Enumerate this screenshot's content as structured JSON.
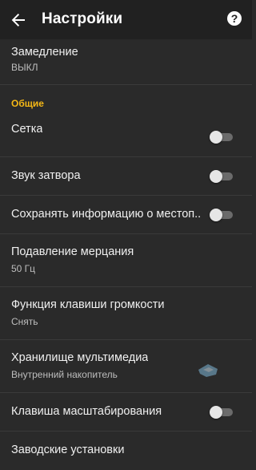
{
  "appbar": {
    "title": "Настройки",
    "back_icon": "arrow-back-icon",
    "help_icon": "help-icon",
    "help_glyph": "?"
  },
  "items": [
    {
      "title": "Замедление",
      "value": "ВЫКЛ"
    }
  ],
  "section": {
    "label": "Общие"
  },
  "general": {
    "grid": {
      "title": "Сетка",
      "toggle_on": false
    },
    "shutter_sound": {
      "title": "Звук затвора",
      "toggle_on": false
    },
    "save_location": {
      "title": "Сохранять информацию о местоп..",
      "toggle_on": false
    },
    "flicker": {
      "title": "Подавление мерцания",
      "value": "50 Гц"
    },
    "volume_key": {
      "title": "Функция клавиши громкости",
      "value": "Снять"
    },
    "storage": {
      "title": "Хранилище мультимедиа",
      "value": "Внутренний накопитель"
    },
    "zoom_key": {
      "title": "Клавиша масштабирования",
      "toggle_on": false
    },
    "factory_reset": {
      "title": "Заводские установки"
    }
  },
  "colors": {
    "background": "#2a2a2a",
    "appbar": "#212121",
    "accent": "#f5b816",
    "toggle_track_off": "#6b6b6b",
    "toggle_thumb_off": "#e6e6e6"
  }
}
